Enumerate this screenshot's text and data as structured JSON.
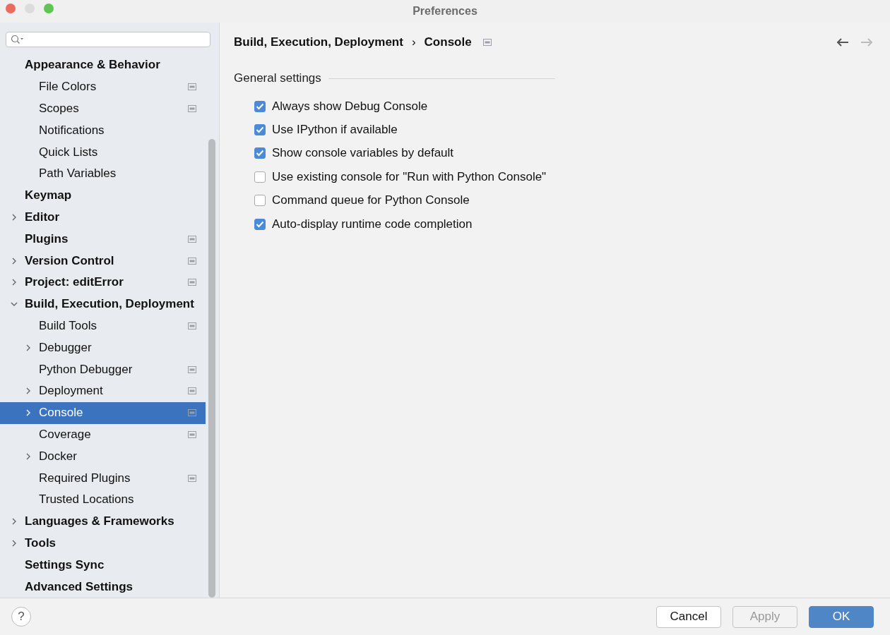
{
  "window": {
    "title": "Preferences"
  },
  "sidebar": {
    "items": [
      {
        "label": "Appearance & Behavior",
        "selected": false,
        "scoped": false,
        "children": [
          {
            "label": "File Colors",
            "selected": false,
            "scoped": true
          },
          {
            "label": "Scopes",
            "selected": false,
            "scoped": true
          },
          {
            "label": "Notifications",
            "selected": false,
            "scoped": false
          },
          {
            "label": "Quick Lists",
            "selected": false,
            "scoped": false
          },
          {
            "label": "Path Variables",
            "selected": false,
            "scoped": false
          }
        ]
      },
      {
        "label": "Keymap",
        "selected": false,
        "scoped": false
      },
      {
        "label": "Editor",
        "selected": false,
        "scoped": false,
        "expanded": false
      },
      {
        "label": "Plugins",
        "selected": false,
        "scoped": true
      },
      {
        "label": "Version Control",
        "selected": false,
        "scoped": true,
        "expanded": false
      },
      {
        "label": "Project: editError",
        "selected": false,
        "scoped": true,
        "expanded": false
      },
      {
        "label": "Build, Execution, Deployment",
        "selected": false,
        "scoped": false,
        "expanded": true,
        "children": [
          {
            "label": "Build Tools",
            "selected": false,
            "scoped": true
          },
          {
            "label": "Debugger",
            "selected": false,
            "scoped": false,
            "expanded": false
          },
          {
            "label": "Python Debugger",
            "selected": false,
            "scoped": true
          },
          {
            "label": "Deployment",
            "selected": false,
            "scoped": true,
            "expanded": false
          },
          {
            "label": "Console",
            "selected": true,
            "scoped": true,
            "expanded": false
          },
          {
            "label": "Coverage",
            "selected": false,
            "scoped": true
          },
          {
            "label": "Docker",
            "selected": false,
            "scoped": false,
            "expanded": false
          },
          {
            "label": "Required Plugins",
            "selected": false,
            "scoped": true
          },
          {
            "label": "Trusted Locations",
            "selected": false,
            "scoped": false
          }
        ]
      },
      {
        "label": "Languages & Frameworks",
        "selected": false,
        "scoped": false,
        "expanded": false
      },
      {
        "label": "Tools",
        "selected": false,
        "scoped": false,
        "expanded": false
      },
      {
        "label": "Settings Sync",
        "selected": false,
        "scoped": false
      },
      {
        "label": "Advanced Settings",
        "selected": false,
        "scoped": false
      }
    ]
  },
  "breadcrumb": {
    "items": [
      "Build, Execution, Deployment",
      "Console"
    ],
    "separator": "›",
    "scoped": true
  },
  "section": {
    "title": "General settings"
  },
  "options": [
    {
      "label": "Always show Debug Console",
      "checked": true
    },
    {
      "label": "Use IPython if available",
      "checked": true
    },
    {
      "label": "Show console variables by default",
      "checked": true
    },
    {
      "label": "Use existing console for \"Run with Python Console\"",
      "checked": false
    },
    {
      "label": "Command queue for Python Console",
      "checked": false
    },
    {
      "label": "Auto-display runtime code completion",
      "checked": true
    }
  ],
  "help": "?",
  "buttons": [
    {
      "label": "Cancel",
      "kind": "normal",
      "disabled": false
    },
    {
      "label": "Apply",
      "kind": "normal",
      "disabled": true
    },
    {
      "label": "OK",
      "kind": "default",
      "disabled": false
    }
  ]
}
